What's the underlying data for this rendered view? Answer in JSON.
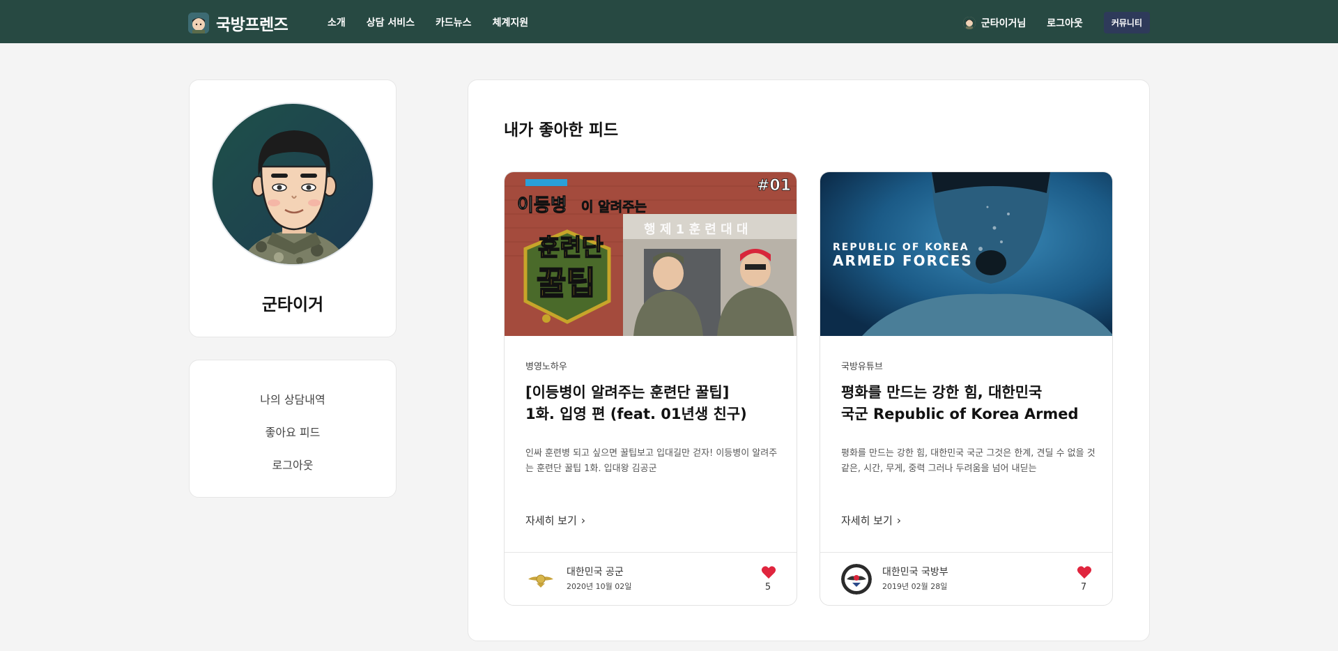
{
  "nav": {
    "brand": "국방프렌즈",
    "links": [
      "소개",
      "상담 서비스",
      "카드뉴스",
      "체계지원"
    ],
    "user_name": "군타이거님",
    "logout": "로그아웃",
    "community": "커뮤니티"
  },
  "profile": {
    "name": "군타이거"
  },
  "menu": {
    "items": [
      "나의 상담내역",
      "좋아요 피드",
      "로그아웃"
    ]
  },
  "main": {
    "title": "내가 좋아한 피드",
    "feeds": [
      {
        "thumb_text": {
          "badge": "#01",
          "line1": "이등병",
          "line1b": "이 알려주는",
          "big1": "훈련단",
          "big2": "꿀팁",
          "sign": "행 제 1 훈 련 대 대"
        },
        "category": "병영노하우",
        "title_line1": "[이등병이 알려주는 훈련단 꿀팁]",
        "title_line2": "1화. 입영 편 (feat. 01년생 친구)",
        "desc": "인싸 훈련병 되고 싶으면 꿀팁보고 입대길만 걷자! 이등병이 알려주는 훈련단 꿀팁 1화. 입대왕 김공군",
        "more": "자세히 보기",
        "author": "대한민국 공군",
        "date": "2020년 10월 02일",
        "likes": "5"
      },
      {
        "thumb_text": {
          "line1": "REPUBLIC OF KOREA",
          "line2": "ARMED FORCES"
        },
        "category": "국방유튜브",
        "title_line1": "평화를 만드는 강한 힘, 대한민국",
        "title_line2": "국군 Republic of Korea Armed",
        "desc": "평화를 만드는 강한 힘, 대한민국 국군 그것은 한계, 견딜 수 없을 것 같은, 시간, 무게, 중력 그러나 두려움을 넘어 내딛는",
        "more": "자세히 보기",
        "author": "대한민국 국방부",
        "date": "2019년 02월 28일",
        "likes": "7"
      }
    ]
  },
  "colors": {
    "navbar": "#274942",
    "community_button": "#2e3a5a",
    "heart": "#e0253e"
  }
}
